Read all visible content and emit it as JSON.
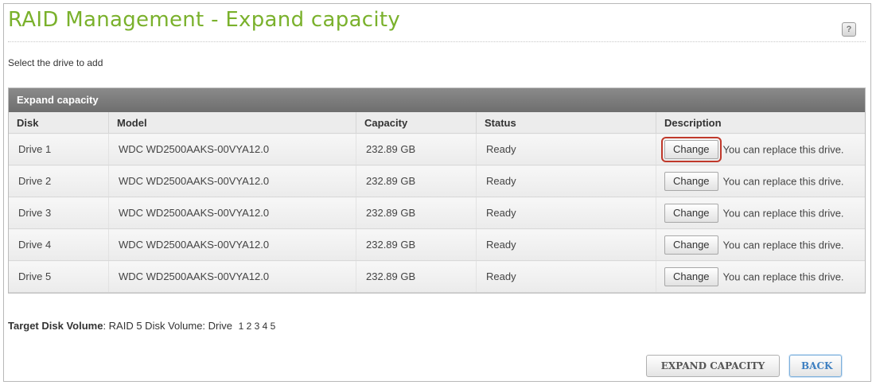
{
  "page": {
    "title": "RAID Management - Expand capacity",
    "instruction": "Select the drive to add"
  },
  "table": {
    "title": "Expand capacity",
    "headers": {
      "disk": "Disk",
      "model": "Model",
      "capacity": "Capacity",
      "status": "Status",
      "description": "Description"
    },
    "rows": [
      {
        "disk": "Drive 1",
        "model": "WDC WD2500AAKS-00VYA12.0",
        "capacity": "232.89 GB",
        "status": "Ready",
        "button": "Change",
        "description": "You can replace this drive.",
        "highlighted": true
      },
      {
        "disk": "Drive 2",
        "model": "WDC WD2500AAKS-00VYA12.0",
        "capacity": "232.89 GB",
        "status": "Ready",
        "button": "Change",
        "description": "You can replace this drive."
      },
      {
        "disk": "Drive 3",
        "model": "WDC WD2500AAKS-00VYA12.0",
        "capacity": "232.89 GB",
        "status": "Ready",
        "button": "Change",
        "description": "You can replace this drive."
      },
      {
        "disk": "Drive 4",
        "model": "WDC WD2500AAKS-00VYA12.0",
        "capacity": "232.89 GB",
        "status": "Ready",
        "button": "Change",
        "description": "You can replace this drive."
      },
      {
        "disk": "Drive 5",
        "model": "WDC WD2500AAKS-00VYA12.0",
        "capacity": "232.89 GB",
        "status": "Ready",
        "button": "Change",
        "description": "You can replace this drive."
      }
    ]
  },
  "target": {
    "label": "Target Disk Volume",
    "value": "RAID 5 Disk Volume: Drive",
    "drives": "1 2 3 4 5"
  },
  "actions": {
    "expand_label": "EXPAND CAPACITY",
    "back_label": "BACK"
  },
  "icons": {
    "help": "help-icon"
  },
  "colors": {
    "title_green": "#7ab12c",
    "table_header_gray": "#7a7a7a",
    "highlight_red": "#c0392b",
    "back_blue": "#3d7fc1"
  }
}
